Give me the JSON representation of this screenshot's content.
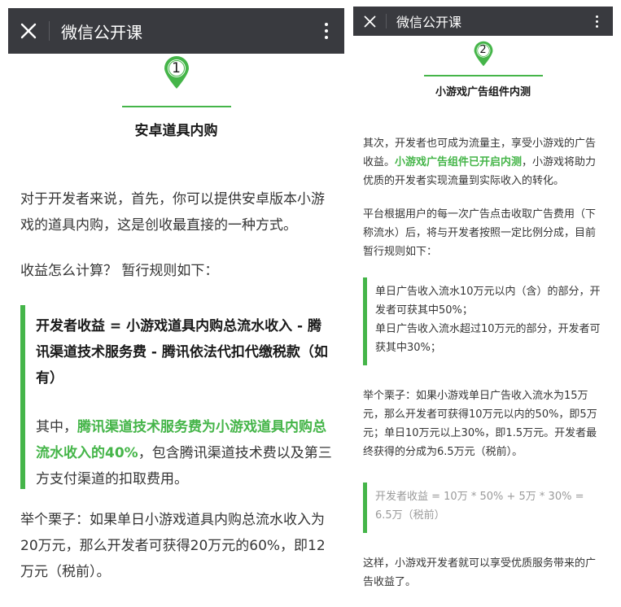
{
  "left": {
    "header": {
      "title": "微信公开课"
    },
    "section": {
      "number": "1",
      "title": "安卓道具内购"
    },
    "para1": "对于开发者来说，首先，你可以提供安卓版本小游戏的道具内购，这是创收最直接的一种方式。",
    "para2": "收益怎么计算？ 暂行规则如下：",
    "quote": {
      "bold": "开发者收益 = 小游戏道具内购总流水收入 - 腾讯渠道技术服务费 - 腾讯依法代扣代缴税款（如有）",
      "p2_prefix": "其中，",
      "p2_highlight": "腾讯渠道技术服务费为小游戏道具内购总流水收入的40%",
      "p2_suffix": "，包含腾讯渠道技术费以及第三方支付渠道的扣取费用。"
    },
    "para3": "举个栗子：如果单日小游戏道具内购总流水收入为20万元，那么开发者可获得20万元的60%，即12万元（税前）。"
  },
  "right": {
    "header": {
      "title": "微信公开课"
    },
    "section": {
      "number": "2",
      "title": "小游戏广告组件内测"
    },
    "para1_prefix": "其次，开发者也可成为流量主，享受小游戏的广告收益。",
    "para1_highlight": "小游戏广告组件已开启内测",
    "para1_suffix": "，小游戏将助力优质的开发者实现流量到实际收入的转化。",
    "para2": "平台根据用户的每一次广告点击收取广告费用（下称流水）后，将与开发者按照一定比例分成，目前暂行规则如下：",
    "quote1": {
      "line1": "单日广告收入流水10万元以内（含）的部分，开发者可获其中50%；",
      "line2": "单日广告收入流水超过10万元的部分，开发者可获其中30%；"
    },
    "para3": "举个栗子：如果小游戏单日广告收入流水为15万元，那么开发者可获得10万元以内的50%，即5万元；单日10万元以上30%，即1.5万元。开发者最终获得的分成为6.5万元（税前）。",
    "quote2": "开发者收益 = 10万 * 50% + 5万 * 30% = 6.5万（税前）",
    "para4": "这样，小游戏开发者就可以享受优质服务带来的广告收益了。"
  },
  "colors": {
    "accent": "#45b549",
    "topbar": "#393a3f"
  },
  "icons": {
    "close": "close-icon",
    "more": "more-vertical-icon",
    "pin": "location-pin-icon"
  }
}
